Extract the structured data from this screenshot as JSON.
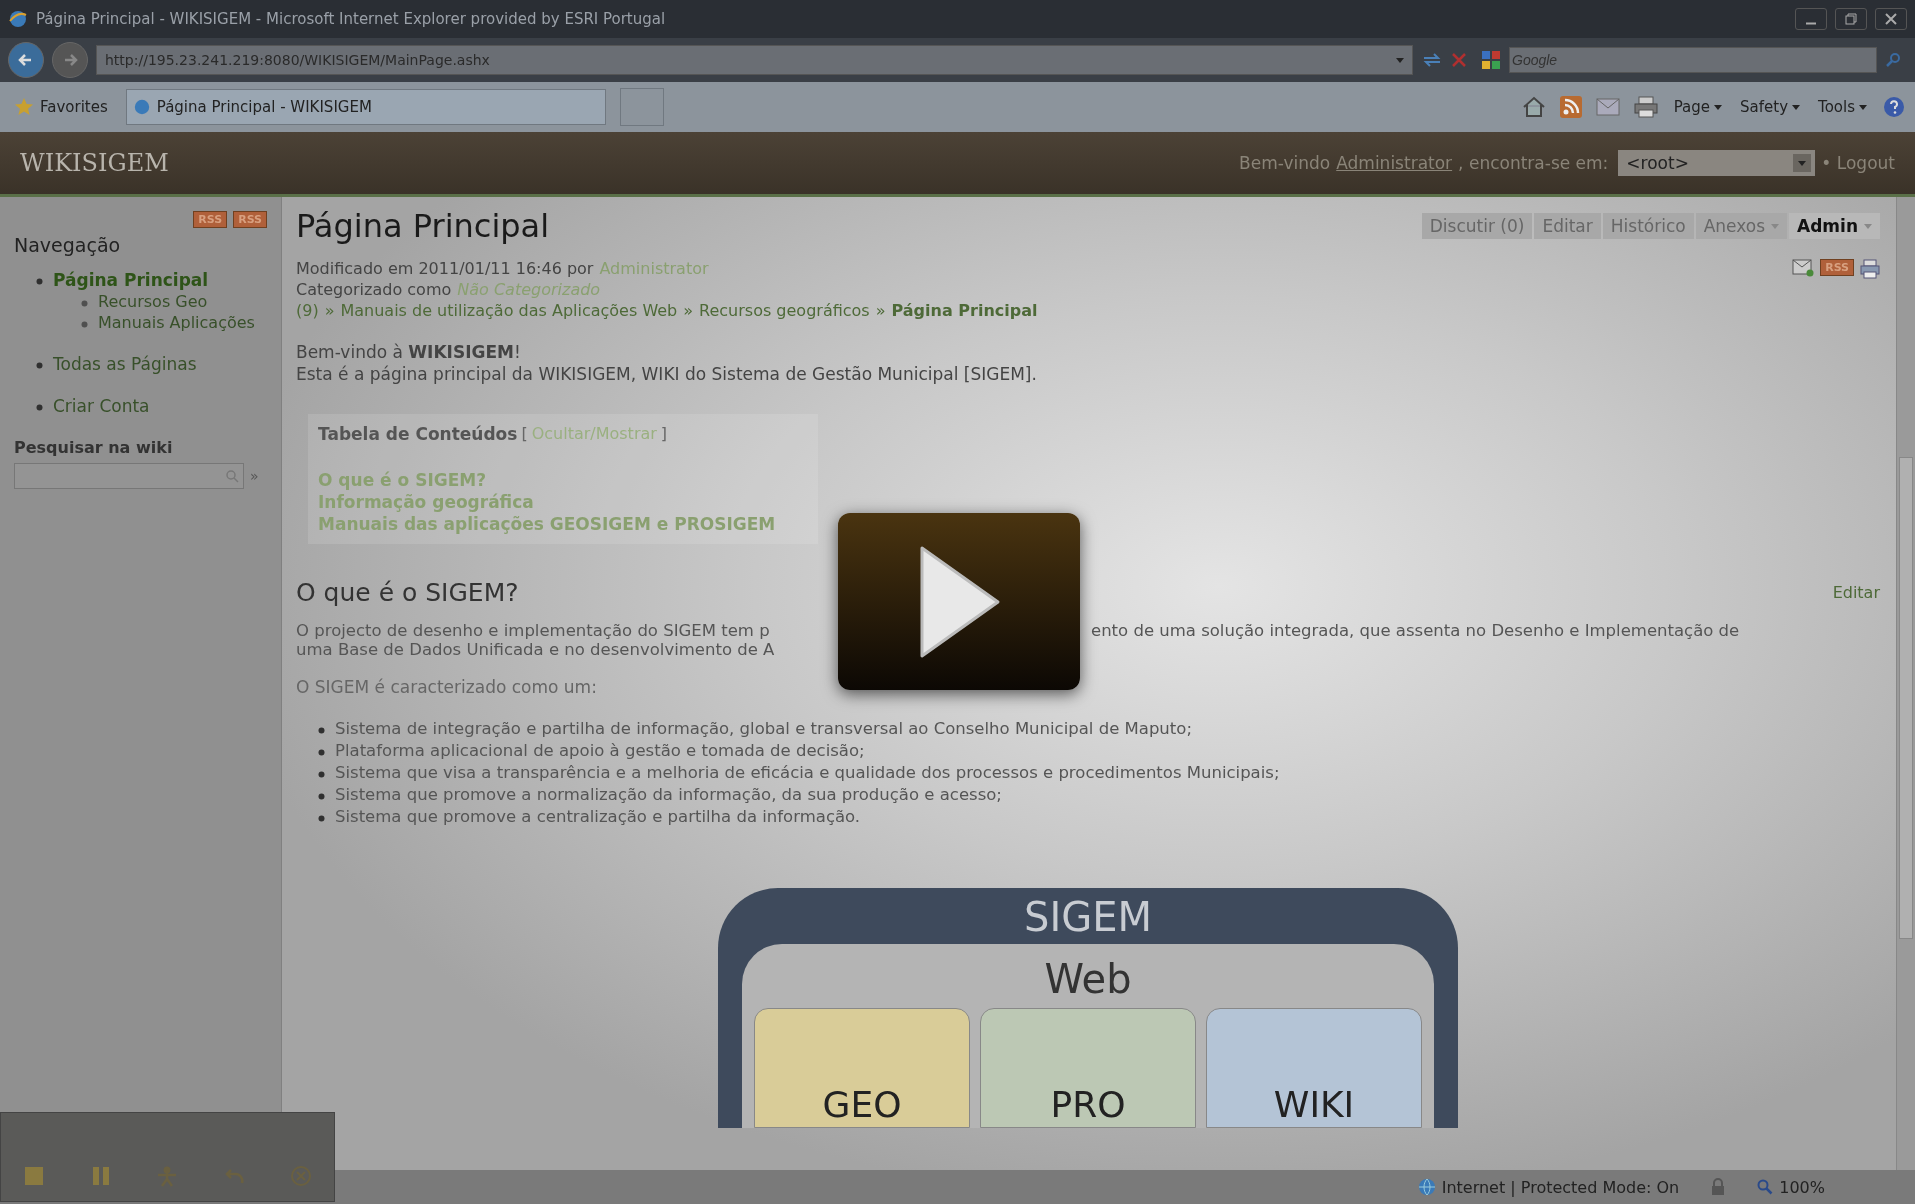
{
  "window": {
    "title": "Página Principal - WIKISIGEM - Microsoft Internet Explorer provided by ESRI Portugal"
  },
  "address_bar": {
    "url": "http://195.23.241.219:8080/WIKISIGEM/MainPage.ashx",
    "search_placeholder": "Google"
  },
  "command_bar": {
    "favorites": "Favorites",
    "tab": "Página Principal - WIKISIGEM",
    "menus": [
      "Page",
      "Safety",
      "Tools"
    ]
  },
  "site_header": {
    "logo": "WIKISIGEM",
    "welcome": "Bem-vindo",
    "user": "Administrator",
    "location_label": ", encontra-se em:",
    "location": "<root>",
    "logout": "• Logout"
  },
  "sidebar": {
    "rss": [
      "RSS",
      "RSS"
    ],
    "title": "Navegação",
    "items": [
      {
        "label": "Página Principal",
        "selected": true,
        "children": [
          {
            "label": "Recursos Geo",
            "selected": false
          },
          {
            "label": "Manuais Aplicações",
            "selected": false
          }
        ]
      },
      {
        "label": "Todas as Páginas",
        "selected": false
      },
      {
        "label": "Criar Conta",
        "selected": false
      }
    ],
    "search_title": "Pesquisar na wiki",
    "search_go": "»"
  },
  "page": {
    "title": "Página Principal",
    "actions": [
      {
        "label": "Discutir (0)",
        "dropdown": false,
        "selected": false
      },
      {
        "label": "Editar",
        "dropdown": false,
        "selected": false
      },
      {
        "label": "Histórico",
        "dropdown": false,
        "selected": false
      },
      {
        "label": "Anexos",
        "dropdown": true,
        "selected": false
      },
      {
        "label": "Admin",
        "dropdown": true,
        "selected": true
      }
    ],
    "rss": "RSS",
    "modified_prefix": "Modificado em 2011/01/11 16:46 por",
    "modified_by": "Administrator",
    "category_prefix": "Categorizado como",
    "category": "Não Categorizado",
    "breadcrumb_separator": "»",
    "breadcrumb": [
      "(9)",
      "Manuais de utilização das Aplicações Web",
      "Recursos geográficos",
      "Página Principal"
    ],
    "intro": "Bem-vindo à **WIKISIGEM**!",
    "description": "Esta é a página principal da WIKISIGEM, WIKI do Sistema de Gestão Municipal [SIGEM].",
    "toc": {
      "title": "Tabela de Conteúdos",
      "toggle_open": "[",
      "toggle": "Ocultar/Mostrar",
      "toggle_close": "]",
      "items": [
        "O que é o SIGEM?",
        "Informação geográfica",
        "Manuais das aplicações GEOSIGEM e PROSIGEM"
      ]
    },
    "section": {
      "title": "O que é o SIGEM?",
      "edit": "Editar",
      "paragraph_left": [
        "O projecto de desenho e implementação do SIGEM tem p",
        "uma Base de Dados Unificada e no desenvolvimento de A"
      ],
      "paragraph_right": "ento de uma solução integrada, que assenta no Desenho e Implementação de",
      "lead": "O SIGEM é caracterizado como um:",
      "bullets": [
        "Sistema de integração e partilha de informação, global e transversal ao Conselho Municipal de Maputo;",
        "Plataforma aplicacional de apoio à gestão e tomada de decisão;",
        "Sistema que visa a transparência e a melhoria de eficácia e qualidade dos processos e procedimentos Municipais;",
        "Sistema que promove a normalização da informação, da sua produção e acesso;",
        "Sistema que promove a centralização e partilha da informação."
      ]
    },
    "diagram": {
      "title": "SIGEM",
      "layer": "Web",
      "modules": [
        {
          "label": "GEO",
          "color": "#d9cc98"
        },
        {
          "label": "PRO",
          "color": "#bcc8b4"
        },
        {
          "label": "WIKI",
          "color": "#b4c4d6"
        }
      ]
    }
  },
  "status_bar": {
    "zone": "Internet | Protected Mode: On",
    "zoom": "100%"
  }
}
